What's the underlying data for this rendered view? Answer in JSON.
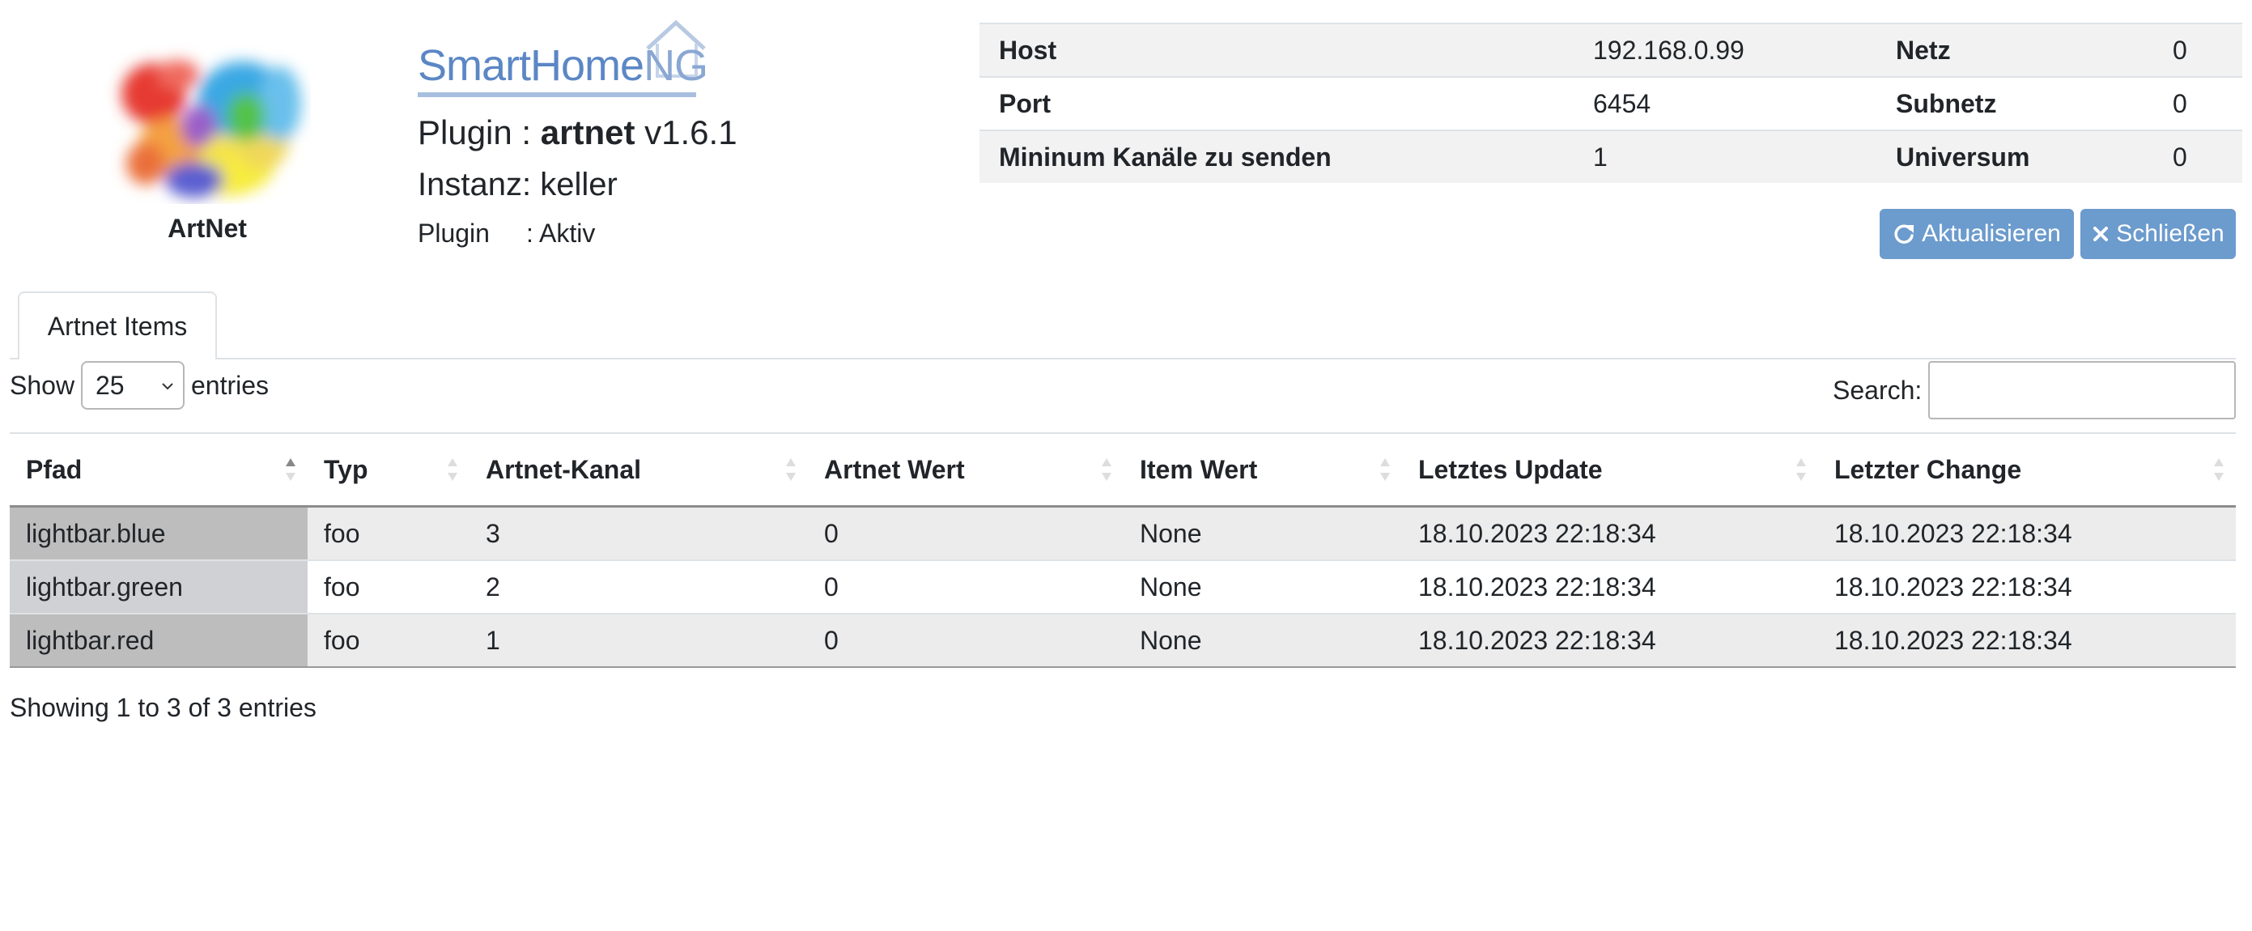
{
  "header": {
    "logo_caption": "ArtNet",
    "brand": {
      "main": "SmartHome",
      "suffix": "NG"
    },
    "plugin_prefix": "Plugin :",
    "plugin_name": "artnet",
    "plugin_version": "v1.6.1",
    "instance_line": "Instanz: keller",
    "status_label": "Plugin",
    "status_value": ": Aktiv"
  },
  "info_table": [
    {
      "k1": "Host",
      "v1": "192.168.0.99",
      "k2": "Netz",
      "v2": "0"
    },
    {
      "k1": "Port",
      "v1": "6454",
      "k2": "Subnetz",
      "v2": "0"
    },
    {
      "k1": "Mininum Kanäle zu senden",
      "v1": "1",
      "k2": "Universum",
      "v2": "0"
    }
  ],
  "buttons": {
    "refresh": {
      "label": "Aktualisieren",
      "icon": "refresh-icon"
    },
    "close": {
      "label": "Schließen",
      "icon": "close-icon"
    }
  },
  "accent_color": "#6c9bcd",
  "tabs": [
    {
      "label": "Artnet Items",
      "active": true
    }
  ],
  "controls": {
    "show_label": "Show",
    "length_value": "25",
    "entries_label": "entries",
    "search_label": "Search:",
    "search_value": ""
  },
  "table": {
    "columns": [
      "Pfad",
      "Typ",
      "Artnet-Kanal",
      "Artnet Wert",
      "Item Wert",
      "Letztes Update",
      "Letzter Change"
    ],
    "sorted_column": "Pfad",
    "rows": [
      [
        "lightbar.blue",
        "foo",
        "3",
        "0",
        "None",
        "18.10.2023 22:18:34",
        "18.10.2023 22:18:34"
      ],
      [
        "lightbar.green",
        "foo",
        "2",
        "0",
        "None",
        "18.10.2023 22:18:34",
        "18.10.2023 22:18:34"
      ],
      [
        "lightbar.red",
        "foo",
        "1",
        "0",
        "None",
        "18.10.2023 22:18:34",
        "18.10.2023 22:18:34"
      ]
    ]
  },
  "footer": {
    "info": "Showing 1 to 3 of 3 entries"
  }
}
